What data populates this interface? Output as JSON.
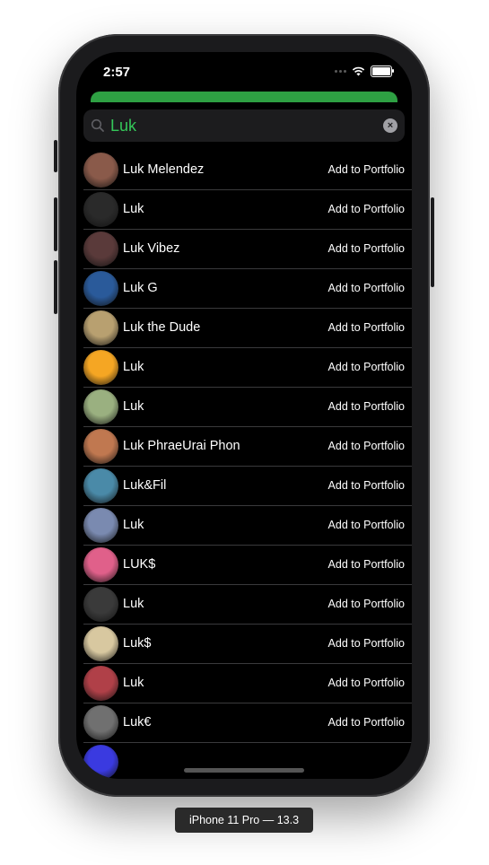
{
  "status_bar": {
    "time": "2:57"
  },
  "search": {
    "value": "Luk",
    "placeholder": ""
  },
  "results": [
    {
      "name": "Luk Melendez",
      "action": "Add to Portfolio",
      "avatar_color": "#8a5a4a"
    },
    {
      "name": "Luk",
      "action": "Add to Portfolio",
      "avatar_color": "#2a2a2a"
    },
    {
      "name": "Luk Vibez",
      "action": "Add to Portfolio",
      "avatar_color": "#5a3a3a"
    },
    {
      "name": "Luk G",
      "action": "Add to Portfolio",
      "avatar_color": "#2a5a9a"
    },
    {
      "name": "Luk the Dude",
      "action": "Add to Portfolio",
      "avatar_color": "#b8a070"
    },
    {
      "name": "Luk",
      "action": "Add to Portfolio",
      "avatar_color": "#f5a623"
    },
    {
      "name": "Luk",
      "action": "Add to Portfolio",
      "avatar_color": "#9ab080"
    },
    {
      "name": "Luk PhraeUrai Phon",
      "action": "Add to Portfolio",
      "avatar_color": "#c07850"
    },
    {
      "name": "Luk&Fil",
      "action": "Add to Portfolio",
      "avatar_color": "#4a8aa8"
    },
    {
      "name": "Luk",
      "action": "Add to Portfolio",
      "avatar_color": "#7a8ab0"
    },
    {
      "name": "LUK$",
      "action": "Add to Portfolio",
      "avatar_color": "#e0608a"
    },
    {
      "name": "Luk",
      "action": "Add to Portfolio",
      "avatar_color": "#3a3a3a"
    },
    {
      "name": "Luk$",
      "action": "Add to Portfolio",
      "avatar_color": "#d8c8a0"
    },
    {
      "name": "Luk",
      "action": "Add to Portfolio",
      "avatar_color": "#b04048"
    },
    {
      "name": "Luk€",
      "action": "Add to Portfolio",
      "avatar_color": "#707070"
    },
    {
      "name": "",
      "action": "",
      "avatar_color": "#3a3ae0"
    }
  ],
  "device_label": "iPhone 11 Pro — 13.3",
  "colors": {
    "accent_green": "#2ea043",
    "search_text": "#34c759"
  }
}
